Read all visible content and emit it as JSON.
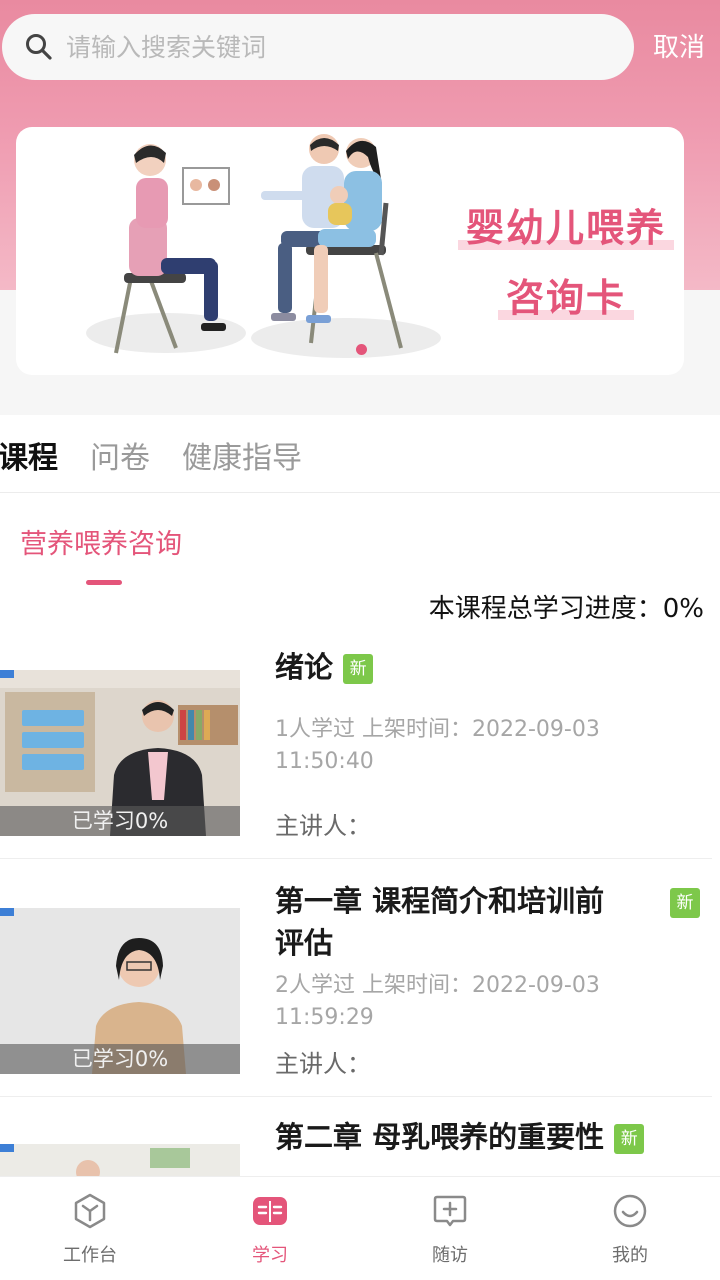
{
  "search": {
    "placeholder": "请输入搜索关键词",
    "cancel_label": "取消"
  },
  "banner": {
    "title_line1": "婴幼儿喂养",
    "title_line2": "咨询卡"
  },
  "tabs": [
    {
      "label": "课程",
      "active": true
    },
    {
      "label": "问卷",
      "active": false
    },
    {
      "label": "健康指导",
      "active": false
    }
  ],
  "subtab": {
    "label": "营养喂养咨询"
  },
  "progress": {
    "label": "本课程总学习进度：0%",
    "percent": 0
  },
  "new_badge": "新",
  "courses": [
    {
      "title": "绪论",
      "meta_line1": "1人学过 上架时间：2022-09-03",
      "meta_line2": "11:50:40",
      "speaker": "主讲人：",
      "thumb_caption": "已学习0%",
      "learned_percent": 0
    },
    {
      "title_line1": "第一章 课程简介和培训前",
      "title_line2": "评估",
      "meta_line1": "2人学过 上架时间：2022-09-03",
      "meta_line2": "11:59:29",
      "speaker": "主讲人：",
      "thumb_caption": "已学习0%",
      "learned_percent": 0
    },
    {
      "title": "第二章 母乳喂养的重要性"
    }
  ],
  "bottom_nav": [
    {
      "label": "工作台",
      "icon": "workbench-hexagon-icon",
      "active": false
    },
    {
      "label": "学习",
      "icon": "book-icon",
      "active": true
    },
    {
      "label": "随访",
      "icon": "plus-chat-icon",
      "active": false
    },
    {
      "label": "我的",
      "icon": "smile-icon",
      "active": false
    }
  ],
  "colors": {
    "accent": "#e4557a",
    "header": "#ef9bb0",
    "badge": "#7dc84a"
  }
}
